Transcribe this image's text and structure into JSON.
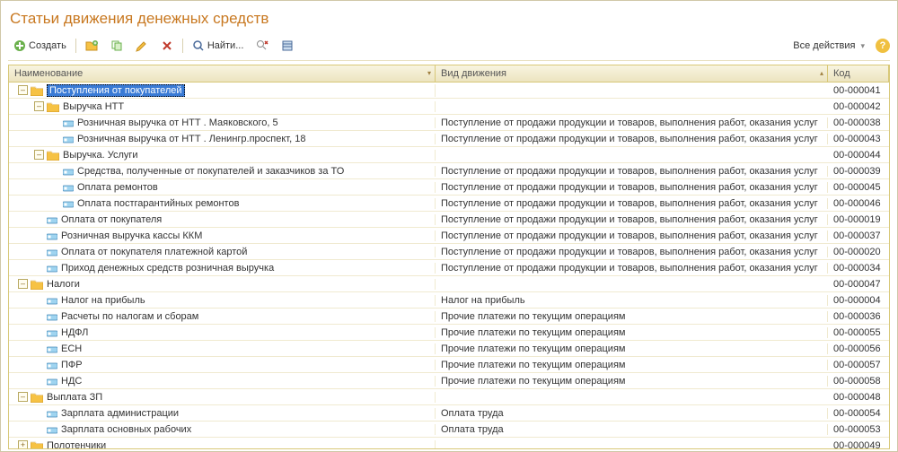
{
  "title": "Статьи движения денежных средств",
  "toolbar": {
    "create": "Создать",
    "find": "Найти...",
    "allActions": "Все действия"
  },
  "columns": {
    "name": "Наименование",
    "type": "Вид движения",
    "code": "Код"
  },
  "typeReceipt": "Поступление от продажи продукции и товаров, выполнения работ, оказания услуг",
  "typeOther": "Прочие платежи по текущим операциям",
  "rows": [
    {
      "lvl": 0,
      "kind": "folder",
      "tg": "-",
      "name": "Поступления от покупателей",
      "type": "",
      "code": "00-000041",
      "sel": true
    },
    {
      "lvl": 1,
      "kind": "folder",
      "tg": "-",
      "name": "Выручка НТТ",
      "type": "",
      "code": "00-000042"
    },
    {
      "lvl": 2,
      "kind": "leaf",
      "tg": "",
      "name": "Розничная выручка от НТТ . Маяковского, 5",
      "typeRef": "typeReceipt",
      "code": "00-000038"
    },
    {
      "lvl": 2,
      "kind": "leaf",
      "tg": "",
      "name": "Розничная выручка от НТТ . Ленингр.проспект, 18",
      "typeRef": "typeReceipt",
      "code": "00-000043"
    },
    {
      "lvl": 1,
      "kind": "folder",
      "tg": "-",
      "name": "Выручка. Услуги",
      "type": "",
      "code": "00-000044"
    },
    {
      "lvl": 2,
      "kind": "leaf",
      "tg": "",
      "name": "Средства, полученные от покупателей и заказчиков за ТО",
      "typeRef": "typeReceipt",
      "code": "00-000039"
    },
    {
      "lvl": 2,
      "kind": "leaf",
      "tg": "",
      "name": "Оплата ремонтов",
      "typeRef": "typeReceipt",
      "code": "00-000045"
    },
    {
      "lvl": 2,
      "kind": "leaf",
      "tg": "",
      "name": "Оплата постгарантийных ремонтов",
      "typeRef": "typeReceipt",
      "code": "00-000046"
    },
    {
      "lvl": 1,
      "kind": "leaf",
      "tg": "",
      "name": "Оплата от покупателя",
      "typeRef": "typeReceipt",
      "code": "00-000019"
    },
    {
      "lvl": 1,
      "kind": "leaf",
      "tg": "",
      "name": "Розничная выручка кассы ККМ",
      "typeRef": "typeReceipt",
      "code": "00-000037"
    },
    {
      "lvl": 1,
      "kind": "leaf",
      "tg": "",
      "name": "Оплата от покупателя платежной картой",
      "typeRef": "typeReceipt",
      "code": "00-000020"
    },
    {
      "lvl": 1,
      "kind": "leaf",
      "tg": "",
      "name": "Приход денежных средств розничная выручка",
      "typeRef": "typeReceipt",
      "code": "00-000034"
    },
    {
      "lvl": 0,
      "kind": "folder",
      "tg": "-",
      "name": "Налоги",
      "type": "",
      "code": "00-000047"
    },
    {
      "lvl": 1,
      "kind": "leaf",
      "tg": "",
      "name": "Налог на прибыль",
      "type": "Налог на прибыль",
      "code": "00-000004"
    },
    {
      "lvl": 1,
      "kind": "leaf",
      "tg": "",
      "name": "Расчеты по налогам и сборам",
      "typeRef": "typeOther",
      "code": "00-000036"
    },
    {
      "lvl": 1,
      "kind": "leaf",
      "tg": "",
      "name": "НДФЛ",
      "typeRef": "typeOther",
      "code": "00-000055"
    },
    {
      "lvl": 1,
      "kind": "leaf",
      "tg": "",
      "name": "ЕСН",
      "typeRef": "typeOther",
      "code": "00-000056"
    },
    {
      "lvl": 1,
      "kind": "leaf",
      "tg": "",
      "name": "ПФР",
      "typeRef": "typeOther",
      "code": "00-000057"
    },
    {
      "lvl": 1,
      "kind": "leaf",
      "tg": "",
      "name": "НДС",
      "typeRef": "typeOther",
      "code": "00-000058"
    },
    {
      "lvl": 0,
      "kind": "folder",
      "tg": "-",
      "name": "Выплата ЗП",
      "type": "",
      "code": "00-000048"
    },
    {
      "lvl": 1,
      "kind": "leaf",
      "tg": "",
      "name": "Зарплата администрации",
      "type": "Оплата труда",
      "code": "00-000054"
    },
    {
      "lvl": 1,
      "kind": "leaf",
      "tg": "",
      "name": "Зарплата основных рабочих",
      "type": "Оплата труда",
      "code": "00-000053"
    },
    {
      "lvl": 0,
      "kind": "folder",
      "tg": "+",
      "name": "Полотенчики",
      "type": "",
      "code": "00-000049"
    }
  ]
}
